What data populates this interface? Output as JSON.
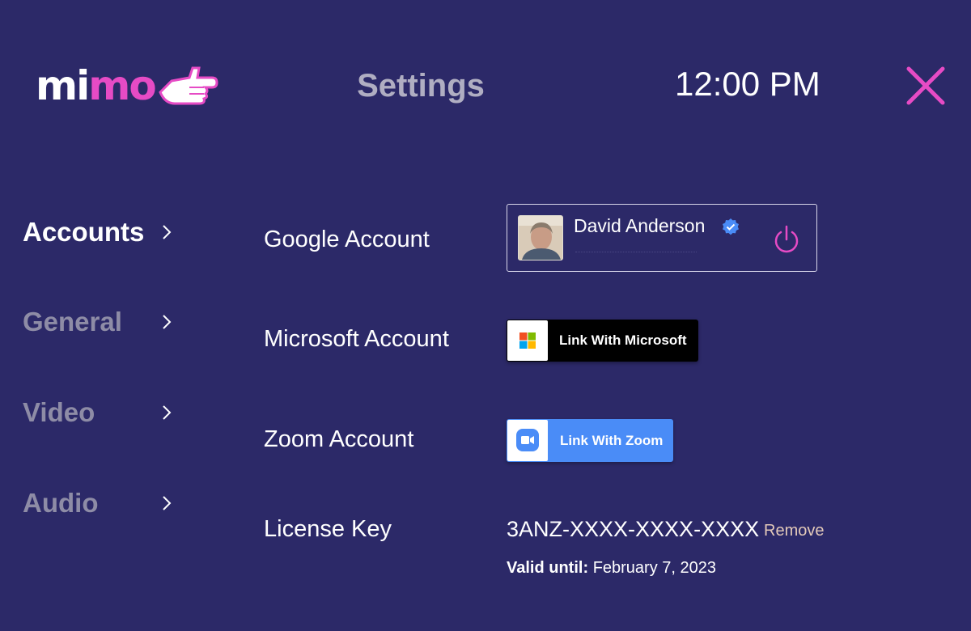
{
  "header": {
    "logo": {
      "part1": "mi",
      "part2": "m",
      "part3": "o"
    },
    "title": "Settings",
    "time": "12:00 PM"
  },
  "sidebar": {
    "items": [
      {
        "label": "Accounts",
        "active": true
      },
      {
        "label": "General",
        "active": false
      },
      {
        "label": "Video",
        "active": false
      },
      {
        "label": "Audio",
        "active": false
      }
    ]
  },
  "accounts": {
    "google": {
      "label": "Google Account",
      "user_name": "David Anderson",
      "verified": true
    },
    "microsoft": {
      "label": "Microsoft Account",
      "button_label": "Link With Microsoft"
    },
    "zoom": {
      "label": "Zoom Account",
      "button_label": "Link With Zoom"
    },
    "license": {
      "label": "License Key",
      "key": "3ANZ-XXXX-XXXX-XXXX",
      "remove_label": "Remove",
      "valid_until_label": "Valid until:",
      "valid_until_value": "February 7, 2023"
    }
  },
  "colors": {
    "background": "#2c2968",
    "accent": "#e64bc5",
    "zoom_blue": "#4a8cf7",
    "muted_text": "#8e8ca6"
  },
  "icons": {
    "close": "close-icon",
    "chevron": "chevron-right-icon",
    "verified": "verified-badge-icon",
    "power": "power-icon",
    "microsoft": "microsoft-logo-icon",
    "zoom": "zoom-camera-icon"
  }
}
